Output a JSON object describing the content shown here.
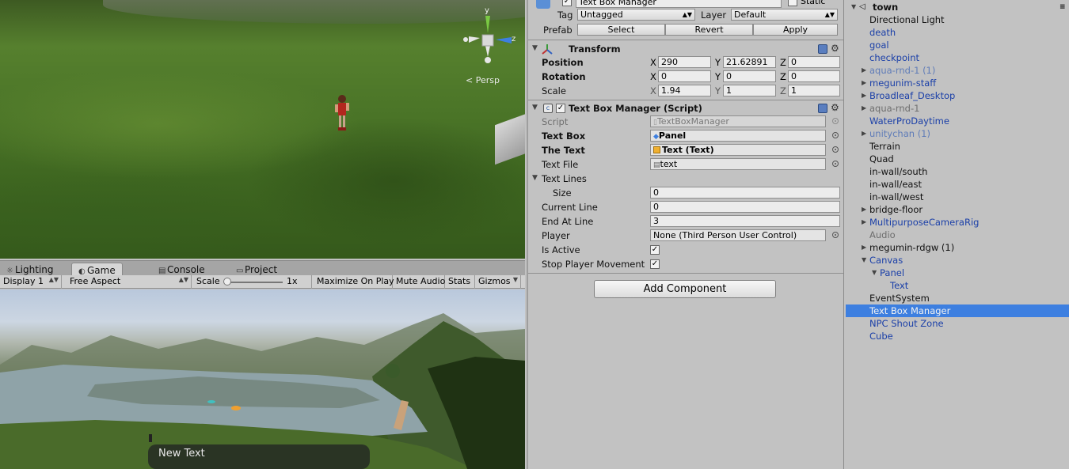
{
  "game_tabs": [
    {
      "label": "Lighting",
      "icon": "lightbulb-icon"
    },
    {
      "label": "Game",
      "icon": "pacman-icon"
    },
    {
      "label": "Console",
      "icon": "console-icon"
    },
    {
      "label": "Project",
      "icon": "folder-icon"
    }
  ],
  "game_toolbar": {
    "display": "Display 1",
    "aspect": "Free Aspect",
    "scale_label": "Scale",
    "scale_value": "1x",
    "maximize": "Maximize On Play",
    "mute": "Mute Audio",
    "stats": "Stats",
    "gizmos": "Gizmos"
  },
  "scene": {
    "persp_label": "Persp",
    "gizmo_axes": [
      "y",
      "z"
    ]
  },
  "game_view": {
    "overlay_text": "New Text"
  },
  "inspector": {
    "object_name": "Text Box Manager",
    "static_label": "Static",
    "tag_label": "Tag",
    "tag_value": "Untagged",
    "layer_label": "Layer",
    "layer_value": "Default",
    "prefab_label": "Prefab",
    "prefab_select": "Select",
    "prefab_revert": "Revert",
    "prefab_apply": "Apply",
    "transform": {
      "title": "Transform",
      "position_label": "Position",
      "rotation_label": "Rotation",
      "scale_label": "Scale",
      "axis_x": "X",
      "axis_y": "Y",
      "axis_z": "Z",
      "position": {
        "x": "290",
        "y": "21.62891",
        "z": "0"
      },
      "rotation": {
        "x": "0",
        "y": "0",
        "z": "0"
      },
      "scale": {
        "x": "1.94",
        "y": "1",
        "z": "1"
      }
    },
    "script_component": {
      "title": "Text Box Manager (Script)",
      "enabled": true,
      "fields": {
        "script_label": "Script",
        "script_value": "TextBoxManager",
        "textbox_label": "Text Box",
        "textbox_value": "Panel",
        "thetext_label": "The Text",
        "thetext_value": "Text (Text)",
        "textfile_label": "Text File",
        "textfile_value": "text",
        "textlines_label": "Text Lines",
        "size_label": "Size",
        "size_value": "0",
        "currentline_label": "Current Line",
        "currentline_value": "0",
        "endatline_label": "End At Line",
        "endatline_value": "3",
        "player_label": "Player",
        "player_value": "None (Third Person User Control)",
        "isactive_label": "Is Active",
        "isactive_value": true,
        "stopmove_label": "Stop Player Movement",
        "stopmove_value": true
      }
    },
    "add_component": "Add Component"
  },
  "hierarchy": {
    "scene_name": "town",
    "items": [
      {
        "label": "Directional Light",
        "style": "black",
        "indent": 0,
        "arrow": ""
      },
      {
        "label": "death",
        "style": "blue",
        "indent": 0,
        "arrow": ""
      },
      {
        "label": "goal",
        "style": "blue",
        "indent": 0,
        "arrow": ""
      },
      {
        "label": "checkpoint",
        "style": "blue",
        "indent": 0,
        "arrow": ""
      },
      {
        "label": "aqua-rnd-1 (1)",
        "style": "faded",
        "indent": 0,
        "arrow": "▶"
      },
      {
        "label": "megunim-staff",
        "style": "blue",
        "indent": 0,
        "arrow": "▶"
      },
      {
        "label": "Broadleaf_Desktop",
        "style": "blue",
        "indent": 0,
        "arrow": "▶"
      },
      {
        "label": "aqua-rnd-1",
        "style": "grey",
        "indent": 0,
        "arrow": "▶"
      },
      {
        "label": "WaterProDaytime",
        "style": "blue",
        "indent": 0,
        "arrow": ""
      },
      {
        "label": "unitychan (1)",
        "style": "faded",
        "indent": 0,
        "arrow": "▶"
      },
      {
        "label": "Terrain",
        "style": "black",
        "indent": 0,
        "arrow": ""
      },
      {
        "label": "Quad",
        "style": "black",
        "indent": 0,
        "arrow": ""
      },
      {
        "label": "in-wall/south",
        "style": "black",
        "indent": 0,
        "arrow": ""
      },
      {
        "label": "in-wall/east",
        "style": "black",
        "indent": 0,
        "arrow": ""
      },
      {
        "label": "in-wall/west",
        "style": "black",
        "indent": 0,
        "arrow": ""
      },
      {
        "label": "bridge-floor",
        "style": "black",
        "indent": 0,
        "arrow": "▶"
      },
      {
        "label": "MultipurposeCameraRig",
        "style": "blue",
        "indent": 0,
        "arrow": "▶"
      },
      {
        "label": "Audio",
        "style": "grey",
        "indent": 0,
        "arrow": ""
      },
      {
        "label": "megumin-rdgw (1)",
        "style": "black",
        "indent": 0,
        "arrow": "▶"
      },
      {
        "label": "Canvas",
        "style": "blue",
        "indent": 0,
        "arrow": "▼"
      },
      {
        "label": "Panel",
        "style": "blue",
        "indent": 1,
        "arrow": "▼"
      },
      {
        "label": "Text",
        "style": "blue",
        "indent": 2,
        "arrow": ""
      },
      {
        "label": "EventSystem",
        "style": "black",
        "indent": 0,
        "arrow": ""
      },
      {
        "label": "Text Box Manager",
        "style": "sel",
        "indent": 0,
        "arrow": ""
      },
      {
        "label": "NPC Shout Zone",
        "style": "blue",
        "indent": 0,
        "arrow": ""
      },
      {
        "label": "Cube",
        "style": "blue",
        "indent": 0,
        "arrow": ""
      }
    ]
  },
  "colors": {
    "selection": "#3d7fe0",
    "prefab_blue": "#1a3fa8",
    "panel_bg": "#c2c2c2"
  }
}
